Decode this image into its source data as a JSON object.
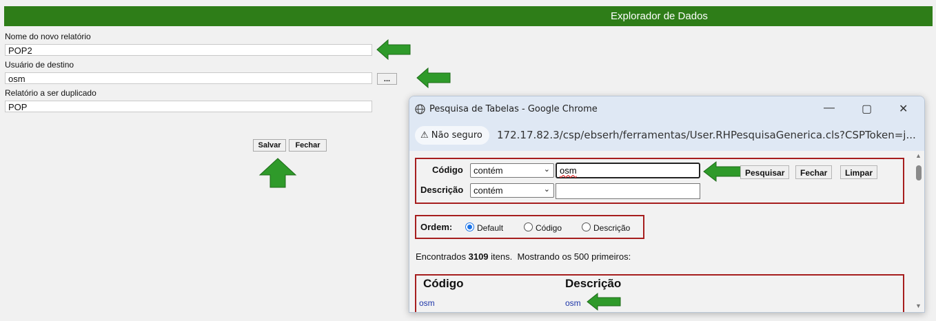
{
  "header": {
    "title": "Explorador de Dados"
  },
  "form": {
    "report_name_label": "Nome do novo relatório",
    "report_name_value": "POP2",
    "dest_user_label": "Usuário de destino",
    "dest_user_value": "osm",
    "lookup_button": "...",
    "source_report_label": "Relatório a ser duplicado",
    "source_report_value": "POP",
    "save_button": "Salvar",
    "close_button": "Fechar"
  },
  "popup": {
    "window_title": "Pesquisa de Tabelas - Google Chrome",
    "security": "Não seguro",
    "url": "172.17.82.3/csp/ebserh/ferramentas/User.RHPesquisaGenerica.cls?CSPToken=j...",
    "filter": {
      "code_label": "Código",
      "code_operator": "contém",
      "code_value": "osm",
      "desc_label": "Descrição",
      "desc_operator": "contém",
      "desc_value": "",
      "search_button": "Pesquisar",
      "close_button": "Fechar",
      "clear_button": "Limpar"
    },
    "order": {
      "label": "Ordem:",
      "options": [
        "Default",
        "Código",
        "Descrição"
      ],
      "selected": "Default"
    },
    "results": {
      "found_prefix": "Encontrados ",
      "found_count": "3109",
      "found_suffix": " itens.  Mostrando os 500 primeiros:",
      "columns": [
        "Código",
        "Descrição"
      ],
      "rows": [
        {
          "code": "osm",
          "description": "osm"
        }
      ]
    }
  },
  "colors": {
    "header_bg": "#2e7d18",
    "arrow": "#2f9a2a",
    "highlight_border": "#a61d1d"
  },
  "icons": [
    "green-arrow-left-icon",
    "green-arrow-up-icon",
    "globe-icon",
    "warning-icon",
    "minimize-icon",
    "maximize-icon",
    "close-icon",
    "chevron-down-icon"
  ]
}
